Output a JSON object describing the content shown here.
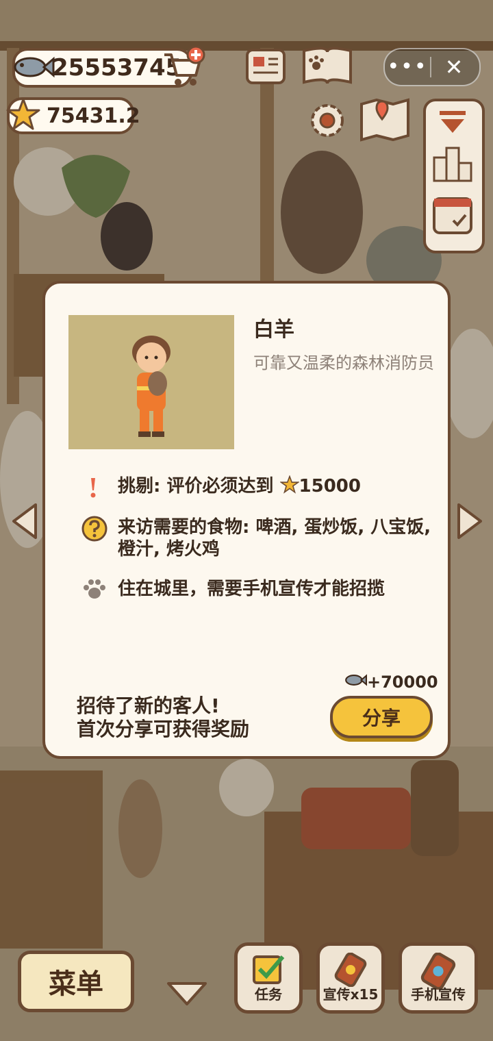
{
  "hud": {
    "fish_count": "25553745",
    "star_count": "75431.2"
  },
  "mini_program": {
    "more_label": "•••",
    "close_label": "✕"
  },
  "customer_card": {
    "name": "白羊",
    "description": "可靠又温柔的森林消防员",
    "requirement_label": "挑剔: 评价必须达到",
    "requirement_value": "15000",
    "food_text": "来访需要的食物: 啤酒, 蛋炒饭, 八宝饭, 橙汁, 烤火鸡",
    "visit_text": "住在城里，需要手机宣传才能招揽",
    "reward_text": "+70000",
    "promo_line1": "招待了新的客人!",
    "promo_line2": "首次分享可获得奖励",
    "share_label": "分享"
  },
  "bottom_bar": {
    "menu_label": "菜单",
    "task_label": "任务",
    "promote_label": "宣传x15",
    "phone_promote_label": "手机宣传"
  },
  "icons": [
    "fish-icon",
    "star-icon",
    "cart-plus-icon",
    "more-icon",
    "close-icon",
    "newspaper-icon",
    "paw-book-icon",
    "gear-icon",
    "map-icon",
    "collapse-icon",
    "ranking-icon",
    "calendar-icon",
    "arrow-left-icon",
    "arrow-right-icon",
    "exclamation-icon",
    "question-icon",
    "paw-icon",
    "checkmark-icon",
    "phone-icon",
    "down-arrow-icon"
  ],
  "colors": {
    "panel_bg": "#fdf8ef",
    "border": "#6b4a32",
    "share_button": "#f5c33c",
    "portrait_bg": "#c7b680"
  }
}
